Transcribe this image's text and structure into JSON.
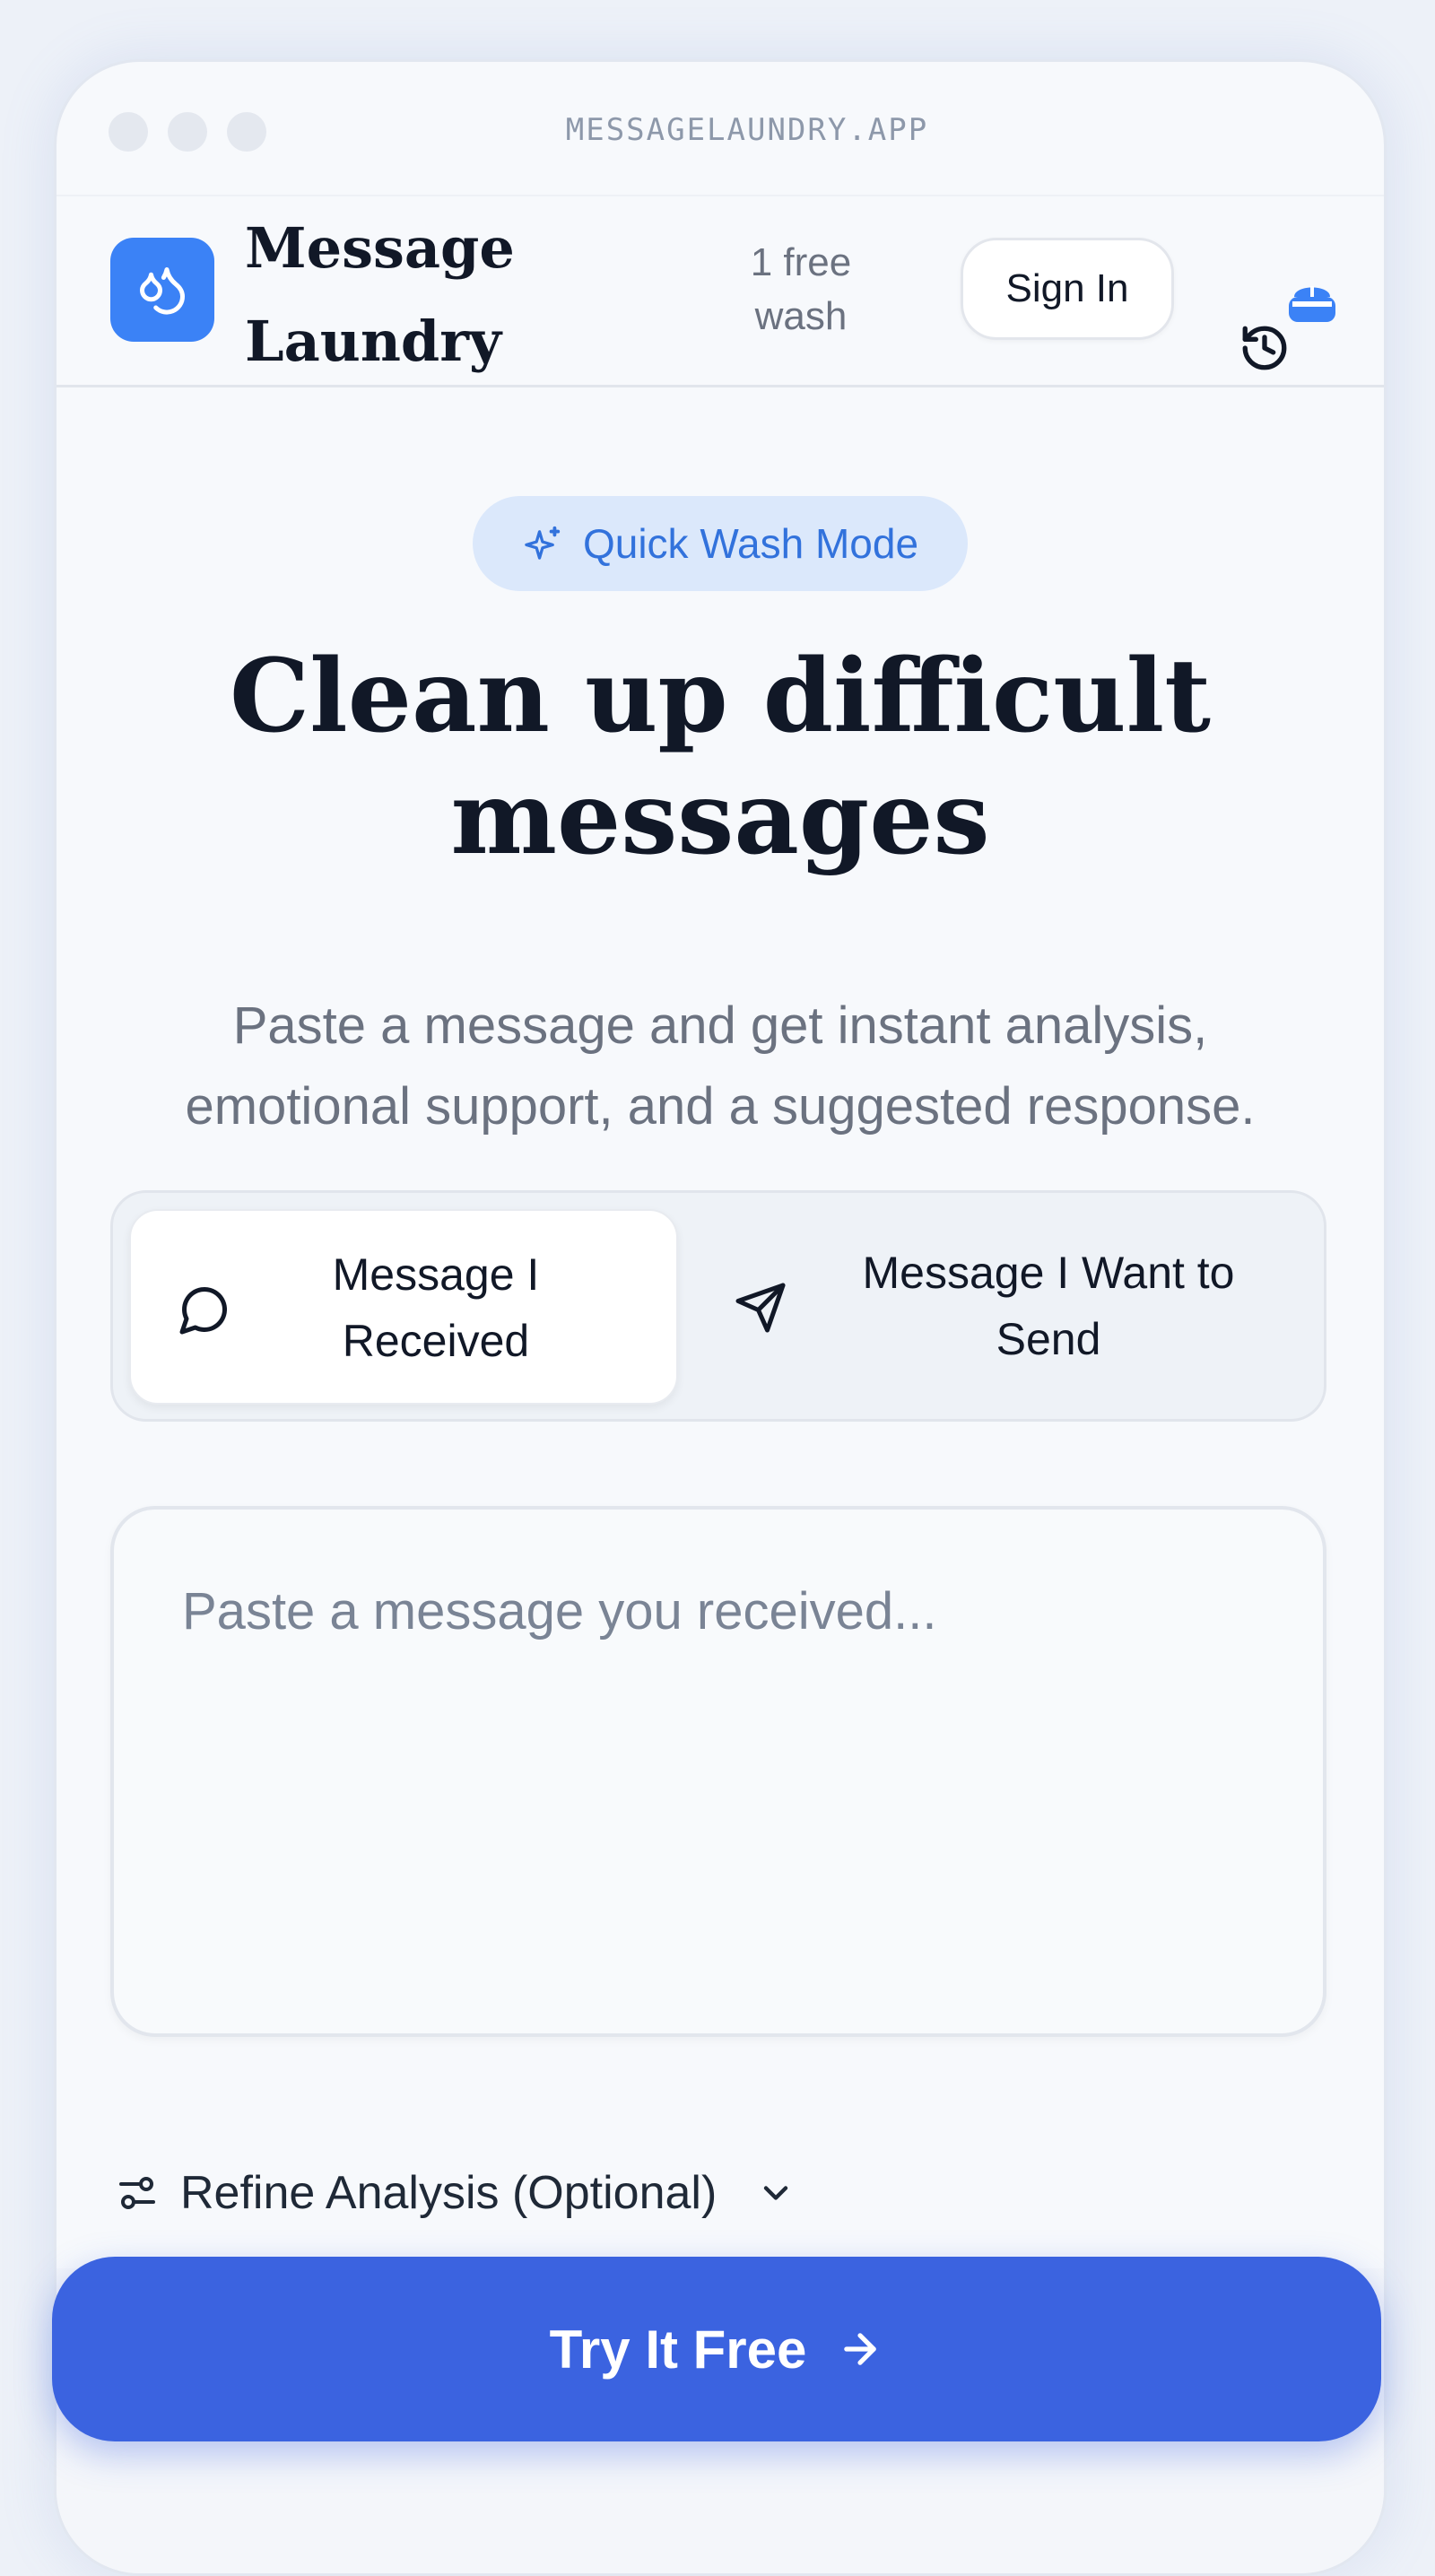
{
  "browser": {
    "url": "MESSAGELAUNDRY.APP"
  },
  "header": {
    "brand_line1": "Message",
    "brand_line2": "Laundry",
    "free_line1": "1 free",
    "free_line2": "wash",
    "sign_in_label": "Sign In",
    "logo_icon": "water-drops-icon",
    "history_icon": "history-icon",
    "badge_icon": "basket-badge-icon"
  },
  "hero": {
    "mode_label": "Quick Wash Mode",
    "mode_icon": "sparkles-icon",
    "title_line1": "Clean up difficult",
    "title_line2": "messages",
    "subtitle_line1": "Paste a message and get instant analysis,",
    "subtitle_line2": "emotional support, and a suggested response."
  },
  "toggle": {
    "selected": "received",
    "received": {
      "line1": "Message I",
      "line2": "Received",
      "icon": "chat-bubble-icon"
    },
    "send": {
      "line1": "Message I Want to",
      "line2": "Send",
      "icon": "send-icon"
    }
  },
  "input": {
    "placeholder": "Paste a message you received...",
    "value": ""
  },
  "refine": {
    "label": "Refine Analysis (Optional)",
    "icon": "sliders-icon",
    "chevron": "chevron-down-icon"
  },
  "cta": {
    "label": "Try It Free",
    "icon": "arrow-right-icon"
  },
  "colors": {
    "accent": "#3b82f6",
    "cta": "#3b63e0",
    "pill_bg": "#dbe8fb",
    "pill_text": "#3272dc"
  }
}
